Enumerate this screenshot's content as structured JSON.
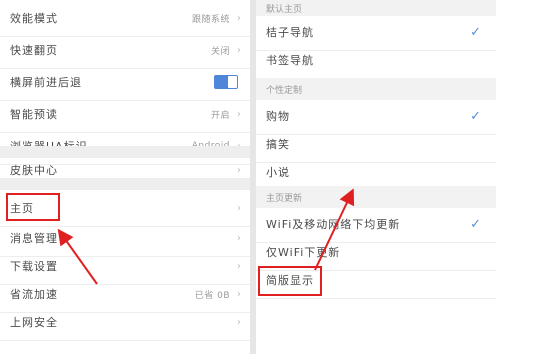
{
  "left": {
    "rows_top": [
      {
        "label": "效能模式",
        "value": "跟随系统"
      },
      {
        "label": "快速翻页",
        "value": "关闭"
      },
      {
        "label": "横屏前进后退",
        "value": ""
      },
      {
        "label": "智能预读",
        "value": "开启"
      },
      {
        "label": "浏览器UA标识",
        "value": "Android"
      }
    ],
    "rows_mid": [
      {
        "label": "皮肤中心"
      }
    ],
    "rows_bottom": [
      {
        "label": "主页",
        "value": ""
      },
      {
        "label": "消息管理",
        "value": ""
      },
      {
        "label": "下载设置",
        "value": ""
      },
      {
        "label": "省流加速",
        "value": "已省 0B"
      },
      {
        "label": "上网安全",
        "value": ""
      }
    ]
  },
  "right": {
    "section_default": "默认主页",
    "default_items": [
      {
        "label": "桔子导航",
        "checked": true
      },
      {
        "label": "书签导航",
        "checked": false
      }
    ],
    "section_custom": "个性定制",
    "custom_items": [
      {
        "label": "购物",
        "checked": true
      },
      {
        "label": "搞笑",
        "checked": false
      },
      {
        "label": "小说",
        "checked": false
      }
    ],
    "section_update": "主页更新",
    "update_items": [
      {
        "label": "WiFi及移动网络下均更新",
        "checked": true
      },
      {
        "label": "仅WiFi下更新",
        "checked": false
      },
      {
        "label": "简版显示",
        "checked": false
      }
    ]
  },
  "icons": {
    "chevron": "›",
    "check": "✓"
  },
  "colors": {
    "highlight": "#e02020",
    "accent": "#4f86d9"
  }
}
